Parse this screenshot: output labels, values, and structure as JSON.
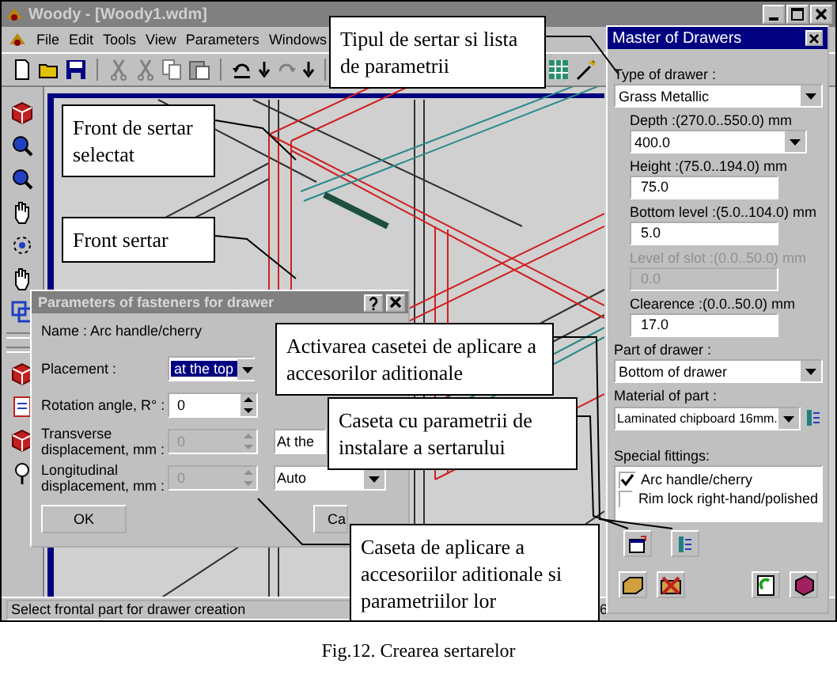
{
  "window": {
    "title": "Woody - [Woody1.wdm]"
  },
  "menu": [
    "File",
    "Edit",
    "Tools",
    "View",
    "Parameters",
    "Windows"
  ],
  "status_bar": {
    "text": "Select frontal part for drawer creation",
    "coordinate": "6"
  },
  "master": {
    "title": "Master of Drawers",
    "fields": [
      {
        "kind": "dropdown",
        "label": "Type of drawer :",
        "value": "Grass Metallic",
        "disabled": false
      },
      {
        "kind": "combo",
        "label": "Depth :(270.0..550.0) mm",
        "value": "400.0",
        "disabled": false
      },
      {
        "kind": "number",
        "label": "Height :(75.0..194.0) mm",
        "value": "75.0",
        "disabled": false
      },
      {
        "kind": "number",
        "label": "Bottom level :(5.0..104.0) mm",
        "value": "5.0",
        "disabled": false
      },
      {
        "kind": "number",
        "label": "Level of slot :(0.0..50.0) mm",
        "value": "0.0",
        "disabled": true
      },
      {
        "kind": "number",
        "label": "Clearence :(0.0..50.0) mm",
        "value": "17.0",
        "disabled": false
      },
      {
        "kind": "dropdown",
        "label": "Part of drawer :",
        "value": "Bottom of drawer",
        "disabled": false
      },
      {
        "kind": "dropdown_button",
        "label": "Material of part :",
        "value": "Laminated chipboard 16mm.",
        "disabled": false
      }
    ],
    "special_fittings": {
      "label": "Special fittings:",
      "items": [
        {
          "label": "Arc handle/cherry",
          "checked": true
        },
        {
          "label": "Rim lock right-hand/polished",
          "checked": false
        }
      ]
    }
  },
  "dialog": {
    "title": "Parameters of fasteners for drawer",
    "name": "Name : Arc handle/cherry",
    "rows": [
      {
        "kind": "dropdown",
        "label": "Placement :",
        "value": "at the top",
        "focused": true,
        "disabled": false
      },
      {
        "kind": "spin",
        "label": "Rotation angle, R° :",
        "value": "0",
        "disabled": false
      },
      {
        "kind": "spin",
        "label": "Transverse displacement, mm :",
        "value": "0",
        "disabled": true,
        "option": "At the"
      },
      {
        "kind": "spin",
        "label": "Longitudinal displacement, mm :",
        "value": "0",
        "disabled": true,
        "option": "Auto"
      }
    ],
    "buttons": [
      "OK",
      "Ca"
    ]
  },
  "callouts": [
    {
      "text": "Tipul de sertar si lista de parametrii"
    },
    {
      "text": "Front de sertar selectat"
    },
    {
      "text": "Front sertar"
    },
    {
      "text": "Activarea casetei de aplicare a accesorilor aditionale"
    },
    {
      "text": "Caseta cu parametrii de instalare a sertarului"
    },
    {
      "text": "Caseta de aplicare a accesoriilor aditionale si parametriilor lor"
    }
  ],
  "caption": "Fig.12. Crearea sertarelor"
}
